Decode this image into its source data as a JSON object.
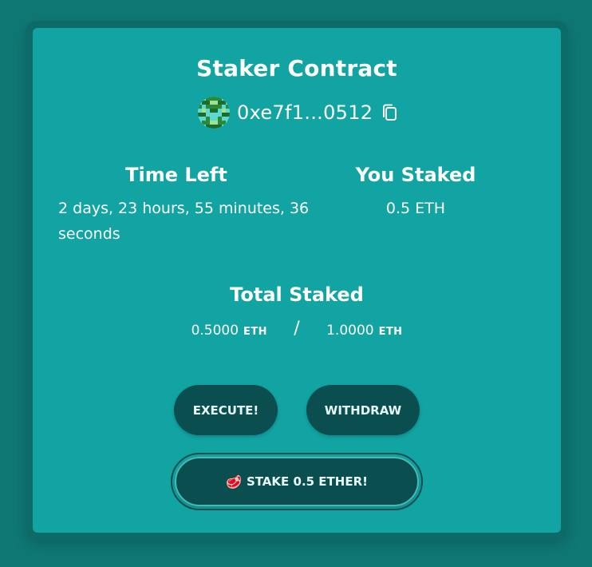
{
  "contract": {
    "title": "Staker Contract",
    "address": "0xe7f1...0512"
  },
  "time_left": {
    "heading": "Time Left",
    "value": "2 days, 23 hours, 55 minutes, 36 seconds"
  },
  "you_staked": {
    "heading": "You Staked",
    "value": "0.5 ETH"
  },
  "total_staked": {
    "heading": "Total Staked",
    "current": "0.5000",
    "current_unit": "ETH",
    "separator": "/",
    "threshold": "1.0000",
    "threshold_unit": "ETH"
  },
  "actions": {
    "execute_label": "EXECUTE!",
    "withdraw_label": "WITHDRAW",
    "stake_emoji": "🥩",
    "stake_label": "STAKE 0.5 ETHER!"
  },
  "icons": {
    "copy": "copy-icon",
    "avatar": "blockie-avatar"
  },
  "colors": {
    "page_background": "#0f7875",
    "card_background": "#12a3a3",
    "button_background": "#0a4e4f",
    "text": "#ffffff"
  }
}
